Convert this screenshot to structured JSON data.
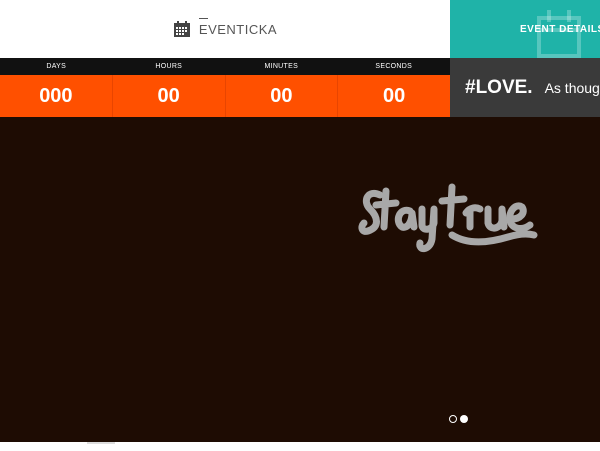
{
  "header": {
    "brand": "EVENTICKA",
    "event_details_label": "EVENT DETAILS"
  },
  "countdown": {
    "labels": [
      "DAYS",
      "HOURS",
      "MINUTES",
      "SECONDS"
    ],
    "values": [
      "000",
      "00",
      "00",
      "00"
    ]
  },
  "ticker": {
    "hashtag": "#LOVE.",
    "message": "As thoug"
  },
  "hero": {
    "logo_text": "Staytrue",
    "slides_total": 2,
    "active_slide": 2
  },
  "colors": {
    "accent_teal": "#1fb3a8",
    "countdown_orange": "#ff5000",
    "hero_bg": "#1e0c03",
    "ticker_bg": "#3a3a3a"
  }
}
